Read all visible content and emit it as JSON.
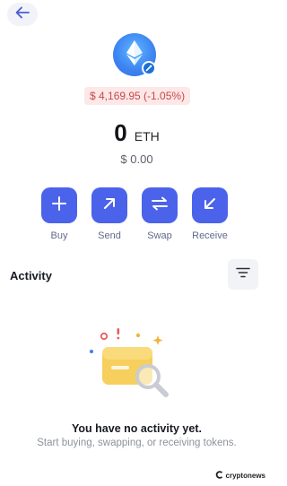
{
  "header": {
    "back_icon": "arrow-left-icon"
  },
  "token": {
    "icon": "ethereum-icon",
    "network_badge_icon": "network-badge-icon",
    "price_change": "$ 4,169.95 (-1.05%)",
    "balance_amount": "0",
    "balance_symbol": "ETH",
    "fiat_value": "$ 0.00"
  },
  "actions": [
    {
      "label": "Buy",
      "icon": "plus-icon"
    },
    {
      "label": "Send",
      "icon": "arrow-up-right-icon"
    },
    {
      "label": "Swap",
      "icon": "swap-icon"
    },
    {
      "label": "Receive",
      "icon": "arrow-down-left-icon"
    }
  ],
  "activity": {
    "title": "Activity",
    "filter_icon": "filter-icon",
    "empty_title": "You have no activity yet.",
    "empty_subtitle": "Start buying, swapping, or receiving tokens."
  },
  "watermark": {
    "text": "cryptonews"
  },
  "colors": {
    "accent": "#4b63ea",
    "price_change_bg": "#fde7e7",
    "price_change_text": "#c64a4a",
    "eth_avatar": "#3f86f2"
  }
}
